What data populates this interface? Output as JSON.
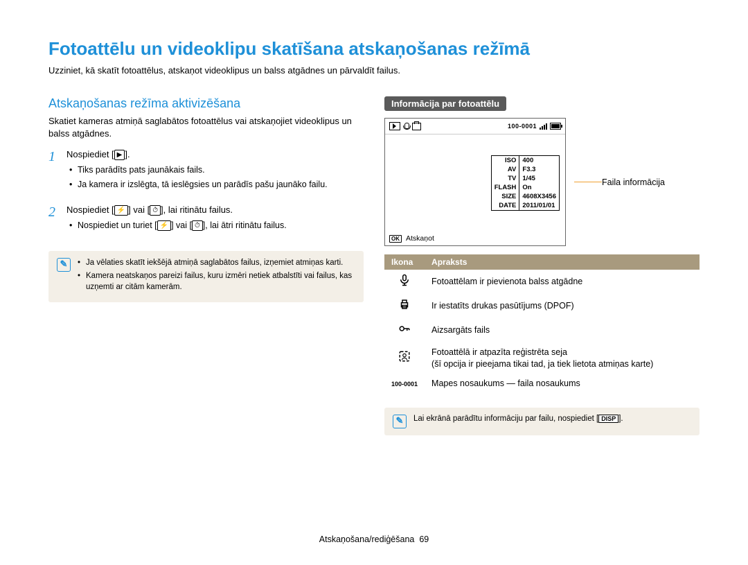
{
  "title": "Fotoattēlu un videoklipu skatīšana atskaņošanas režīmā",
  "intro": "Uzziniet, kā skatīt fotoattēlus, atskaņot videoklipus un balss atgādnes un pārvaldīt failus.",
  "left": {
    "section": "Atskaņošanas režīma aktivizēšana",
    "para": "Skatiet kameras atmiņā saglabātos fotoattēlus vai atskaņojiet videoklipus un balss atgādnes.",
    "step1_pre": "Nospiediet [",
    "step1_post": "].",
    "step1_icon": "▶",
    "step1_b1": "Tiks parādīts pats jaunākais fails.",
    "step1_b2": "Ja kamera ir izslēgta, tā ieslēgsies un parādīs pašu jaunāko failu.",
    "step2_pre": "Nospiediet [",
    "step2_mid1": "] vai [",
    "step2_post": "], lai ritinātu failus.",
    "step2_icon1": "⚡",
    "step2_icon2": "⏱",
    "step2_b1_pre": "Nospiediet un turiet [",
    "step2_b1_mid": "] vai [",
    "step2_b1_post": "], lai ātri ritinātu failus.",
    "note1": "Ja vēlaties skatīt iekšējā atmiņā saglabātos failus, izņemiet atmiņas karti.",
    "note2": "Kamera neatskaņos pareizi failus, kuru izmēri netiek atbalstīti vai failus, kas uzņemti ar citām kamerām."
  },
  "right": {
    "subhead": "Informācija par fotoattēlu",
    "screen": {
      "folder_id": "100-0001",
      "info": {
        "ISO": "400",
        "AV": "F3.3",
        "TV": "1/45",
        "FLASH": "On",
        "SIZE": "4608X3456",
        "DATE": "2011/01/01"
      },
      "ok_label": "Atskaņot"
    },
    "pointer_label": "Faila informācija",
    "table": {
      "h1": "Ikona",
      "h2": "Apraksts",
      "r1": "Fotoattēlam ir pievienota balss atgādne",
      "r2": "Ir iestatīts drukas pasūtījums (DPOF)",
      "r3": "Aizsargāts fails",
      "r4a": "Fotoattēlā ir atpazīta reģistrēta seja",
      "r4b": "(šī opcija ir pieejama tikai tad, ja tiek lietota atmiņas karte)",
      "r5_icon": "100-0001",
      "r5": "Mapes nosaukums — faila nosaukums"
    },
    "note_pre": "Lai ekrānā parādītu informāciju par failu, nospiediet [",
    "note_btn": "DISP",
    "note_post": "]."
  },
  "footer": {
    "section": "Atskaņošana/rediģēšana",
    "page": "69"
  }
}
